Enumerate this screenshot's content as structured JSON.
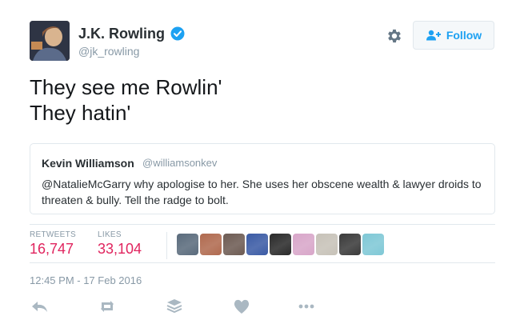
{
  "author": {
    "name": "J.K. Rowling",
    "handle": "@jk_rowling",
    "verified": true
  },
  "header": {
    "follow_label": "Follow",
    "settings_icon": "gear-icon",
    "follow_icon": "follow-person-icon"
  },
  "tweet": {
    "lines": [
      "They see me Rowlin'",
      "They hatin'"
    ]
  },
  "quoted_tweet": {
    "name": "Kevin Williamson",
    "handle": "@williamsonkev",
    "text": "@NatalieMcGarry why apologise to her. She uses her obscene wealth & lawyer droids to threaten & bully. Tell the radge to bolt."
  },
  "stats": {
    "retweets_label": "RETWEETS",
    "retweets_value": "16,747",
    "likes_label": "LIKES",
    "likes_value": "33,104"
  },
  "likers": [
    {
      "name": "liker-avatar-1",
      "color": "#5a6b7c"
    },
    {
      "name": "liker-avatar-2",
      "color": "#b06a4f"
    },
    {
      "name": "liker-avatar-3",
      "color": "#6d5b53"
    },
    {
      "name": "liker-avatar-4",
      "color": "#3b5ba5"
    },
    {
      "name": "liker-avatar-5",
      "color": "#2a2a2a"
    },
    {
      "name": "liker-avatar-6",
      "color": "#d8a6c9"
    },
    {
      "name": "liker-avatar-7",
      "color": "#c7c2b8"
    },
    {
      "name": "liker-avatar-8",
      "color": "#3a3a3a"
    },
    {
      "name": "liker-avatar-9",
      "color": "#7fc8d6"
    }
  ],
  "timestamp": "12:45 PM - 17 Feb 2016",
  "actions": [
    "reply-icon",
    "retweet-icon",
    "stack-icon",
    "heart-icon",
    "more-icon"
  ],
  "colors": {
    "accent": "#1da1f2",
    "like_red": "#e0245e",
    "muted": "#8899a6",
    "action_gray": "#aab8c2"
  }
}
